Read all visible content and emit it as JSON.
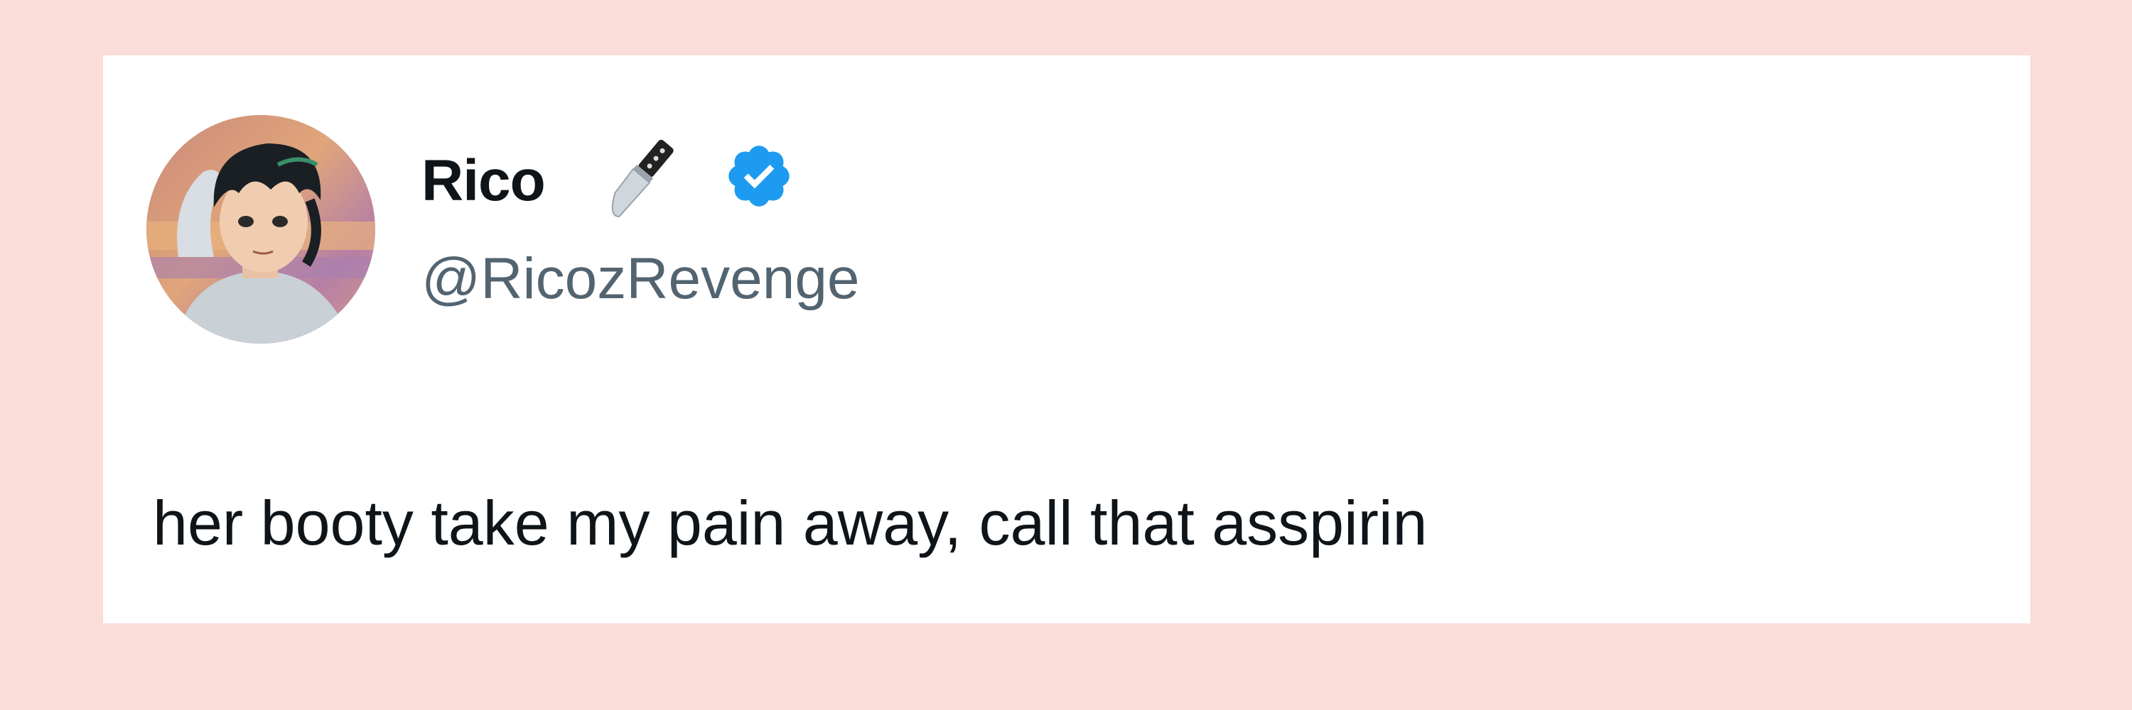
{
  "tweet": {
    "author": {
      "display_name": "Rico",
      "handle": "@RicozRevenge",
      "name_emoji_icon": "kitchen-knife-icon",
      "verified_icon": "verified-badge-icon",
      "verified_color": "#1d9bf0"
    },
    "text": "her booty take my pain away, call that asspirin"
  },
  "colors": {
    "page_background": "#fadcd8",
    "card_background": "#ffffff",
    "primary_text": "#0f1419",
    "secondary_text": "#536471"
  }
}
